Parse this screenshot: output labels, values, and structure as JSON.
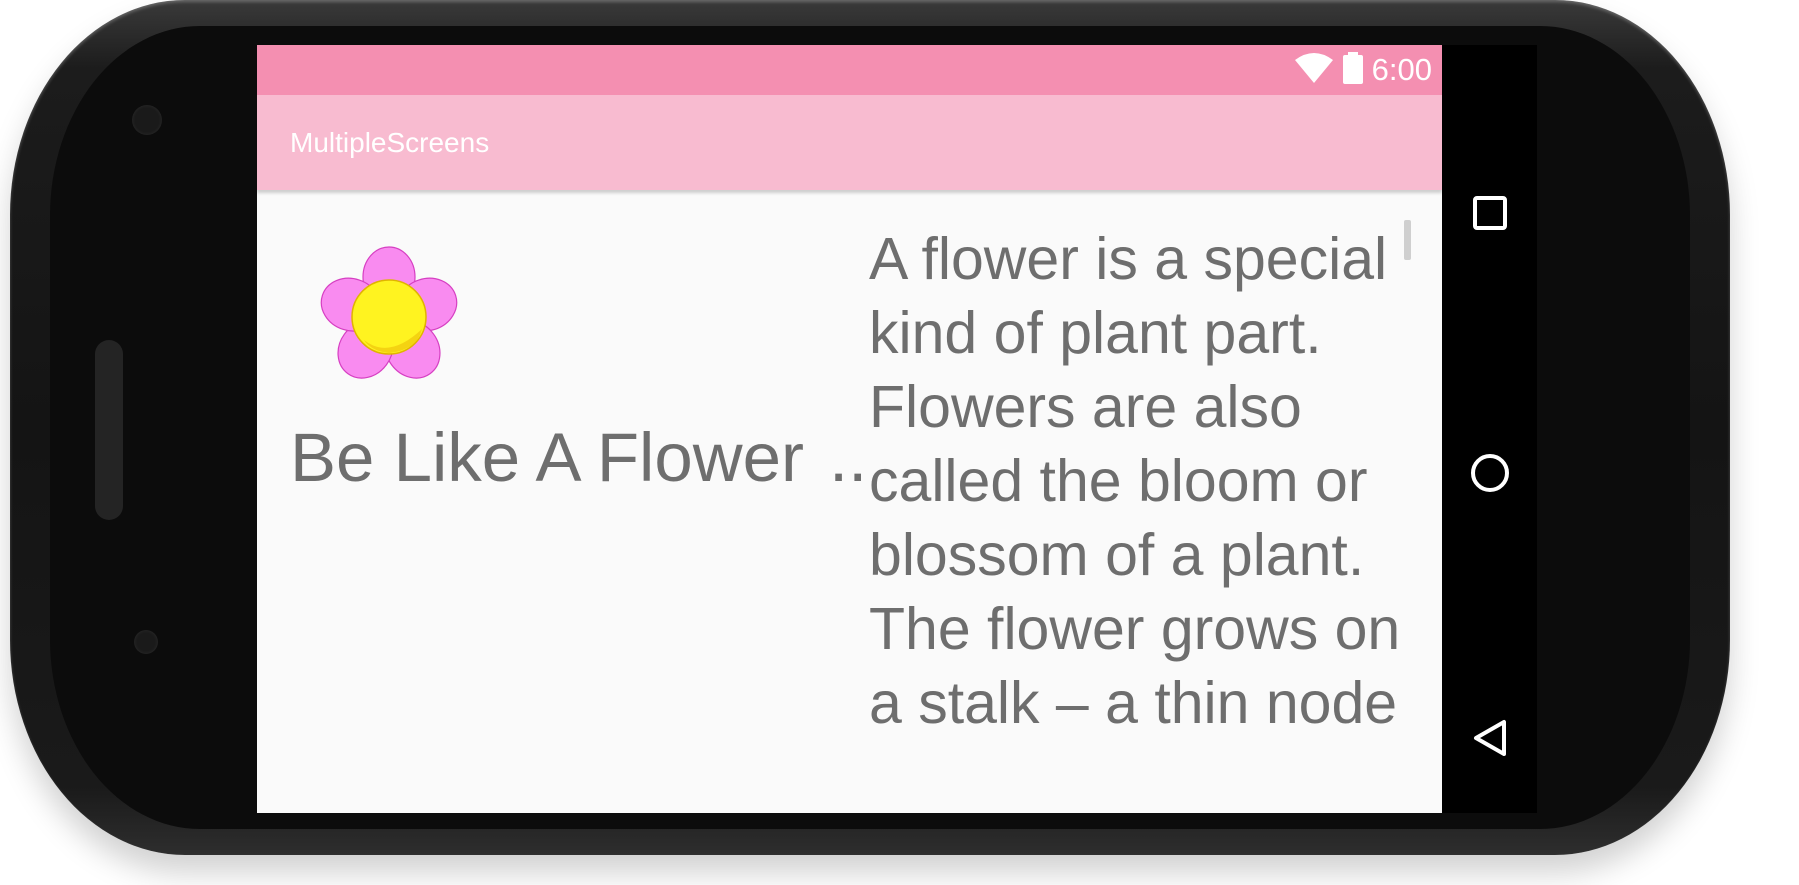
{
  "status_bar": {
    "time": "6:00",
    "icons": [
      "wifi-icon",
      "battery-icon"
    ]
  },
  "app_bar": {
    "title": "MultipleScreens"
  },
  "content": {
    "left_title": "Be Like A Flower",
    "left_title_ellipsis": "..",
    "image": "flower-image",
    "description": "A flower is a special kind of plant part. Flowers are also called the bloom or blossom of a plant. The flower grows on a stalk – a thin node"
  },
  "nav_bar": {
    "buttons": [
      "recents-button",
      "home-button",
      "back-button"
    ]
  },
  "colors": {
    "status_bar": "#f48fb1",
    "app_bar": "#f8bbd0",
    "text": "#6e6e6e",
    "background": "#fafafa"
  }
}
